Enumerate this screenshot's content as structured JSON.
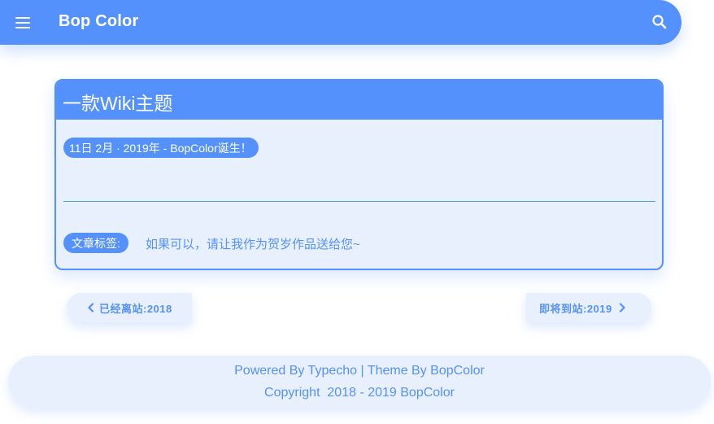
{
  "appbar": {
    "title": "Bop Color",
    "menu_icon": "menu-icon",
    "search_icon": "search-icon",
    "color": "#5591fc"
  },
  "post": {
    "title": "一款Wiki主题",
    "date_line": "11日 2月 · 2019年 - BopColor诞生！",
    "tags_label": "文章标签:",
    "tags_text": "如果可以，请让我作为贺岁作品送给您~"
  },
  "pager": {
    "prev_label": "已经离站:2018",
    "next_label": "即将到站:2019",
    "prev_icon": "chevron-left-icon",
    "next_icon": "chevron-right-icon"
  },
  "footer": {
    "powered_prefix": "Powered By ",
    "powered_link": "Typecho",
    "separator": " | ",
    "theme_prefix": "Theme By ",
    "theme_link": "BopColor",
    "copyright": "Copyright  2018 - 2019 BopColor"
  },
  "colors": {
    "accent": "#5591fc",
    "card_bg": "#e8f0fd",
    "divider": "#4f9fd8"
  }
}
